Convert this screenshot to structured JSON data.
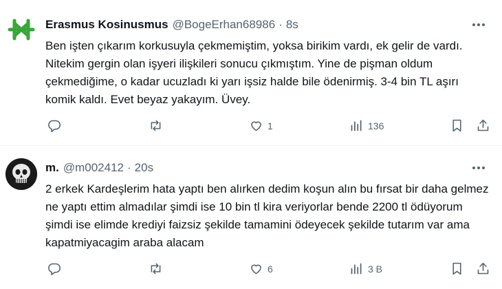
{
  "tweets": [
    {
      "name": "Erasmus Kosinusmus",
      "handle": "@BogeErhan68986",
      "dot": "·",
      "time": "8s",
      "text": "Ben işten çıkarım korkusuyla çekmemiştim, yoksa birikim vardı, ek gelir de vardı. Nitekim gergin olan işyeri ilişkileri sonucu çıkmıştım. Yine de pişman oldum çekmediğime, o kadar ucuzladı ki yarı işsiz halde bile ödenirmiş. 3-4 bin TL aşırı komik kaldı. Evet beyaz yakayım. Üvey.",
      "replies": "",
      "retweets": "",
      "likes": "1",
      "views": "136"
    },
    {
      "name": "m.",
      "handle": "@m002412",
      "dot": "·",
      "time": "20s",
      "text": "2 erkek Kardeşlerim hata yaptı ben alırken dedim koşun alın bu fırsat bir daha gelmez ne yaptı ettim almadılar şimdi ise 10 bin tl kira veriyorlar bende 2200 tl ödüyorum şimdi ise elimde krediyi faizsiz şekilde tamamini ödeyecek şekilde tutarım var ama kapatmiyacagim araba alacam",
      "replies": "",
      "retweets": "",
      "likes": "6",
      "views": "3 B"
    }
  ],
  "icons": {
    "more": "more-icon",
    "reply": "reply-icon",
    "retweet": "retweet-icon",
    "like": "like-icon",
    "views": "views-icon",
    "bookmark": "bookmark-icon",
    "share": "share-icon"
  },
  "colors": {
    "text": "#0f1419",
    "muted": "#536471",
    "divider": "#eff3f4",
    "avatar1": "#3aa63a",
    "avatar2": "#111111"
  }
}
